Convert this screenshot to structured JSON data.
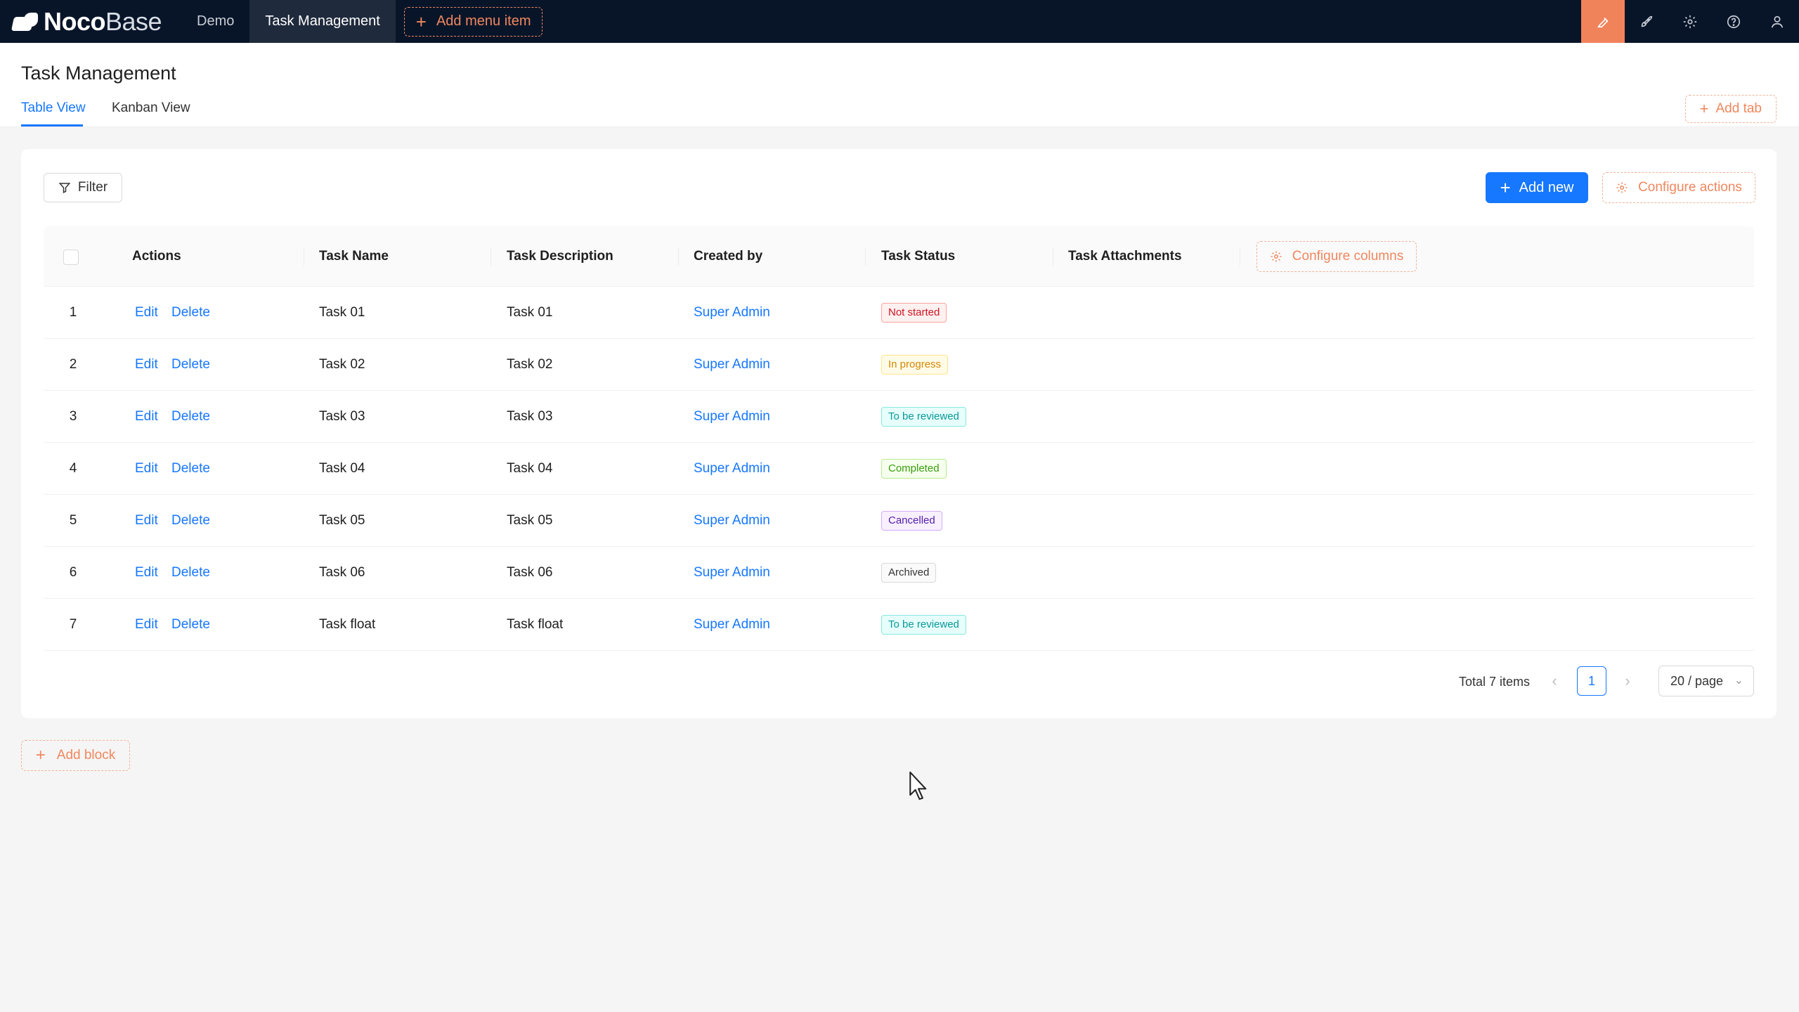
{
  "topbar": {
    "logo_bold": "Noco",
    "logo_light": "Base",
    "nav": [
      "Demo",
      "Task Management"
    ],
    "add_menu_label": "Add menu item",
    "accent_color": "#f1835b"
  },
  "page": {
    "title": "Task Management",
    "tabs": [
      "Table View",
      "Kanban View"
    ],
    "add_tab_label": "Add tab"
  },
  "toolbar": {
    "filter_label": "Filter",
    "add_new_label": "Add new",
    "configure_actions_label": "Configure actions"
  },
  "table": {
    "columns": [
      "Actions",
      "Task Name",
      "Task Description",
      "Created by",
      "Task Status",
      "Task Attachments"
    ],
    "configure_columns_label": "Configure columns",
    "edit_label": "Edit",
    "delete_label": "Delete",
    "rows": [
      {
        "index": "1",
        "name": "Task 01",
        "description": "Task 01",
        "created_by": "Super Admin",
        "status": "Not started",
        "status_color": "#cf1322",
        "status_bg": "#fff1f0",
        "status_border": "#ffa39e"
      },
      {
        "index": "2",
        "name": "Task 02",
        "description": "Task 02",
        "created_by": "Super Admin",
        "status": "In progress",
        "status_color": "#d48806",
        "status_bg": "#fffbe6",
        "status_border": "#ffe58f"
      },
      {
        "index": "3",
        "name": "Task 03",
        "description": "Task 03",
        "created_by": "Super Admin",
        "status": "To be reviewed",
        "status_color": "#08979c",
        "status_bg": "#e6fffb",
        "status_border": "#87e8de"
      },
      {
        "index": "4",
        "name": "Task 04",
        "description": "Task 04",
        "created_by": "Super Admin",
        "status": "Completed",
        "status_color": "#389e0d",
        "status_bg": "#f6ffed",
        "status_border": "#b7eb8f"
      },
      {
        "index": "5",
        "name": "Task 05",
        "description": "Task 05",
        "created_by": "Super Admin",
        "status": "Cancelled",
        "status_color": "#531dab",
        "status_bg": "#f9f0ff",
        "status_border": "#d3adf7"
      },
      {
        "index": "6",
        "name": "Task 06",
        "description": "Task 06",
        "created_by": "Super Admin",
        "status": "Archived",
        "status_color": "#333333",
        "status_bg": "#fafafa",
        "status_border": "#d9d9d9"
      },
      {
        "index": "7",
        "name": "Task float",
        "description": "Task float",
        "created_by": "Super Admin",
        "status": "To be reviewed",
        "status_color": "#08979c",
        "status_bg": "#e6fffb",
        "status_border": "#87e8de"
      }
    ]
  },
  "pagination": {
    "total_label": "Total 7 items",
    "current_page": "1",
    "page_size": "20 / page"
  },
  "add_block_label": "Add block"
}
